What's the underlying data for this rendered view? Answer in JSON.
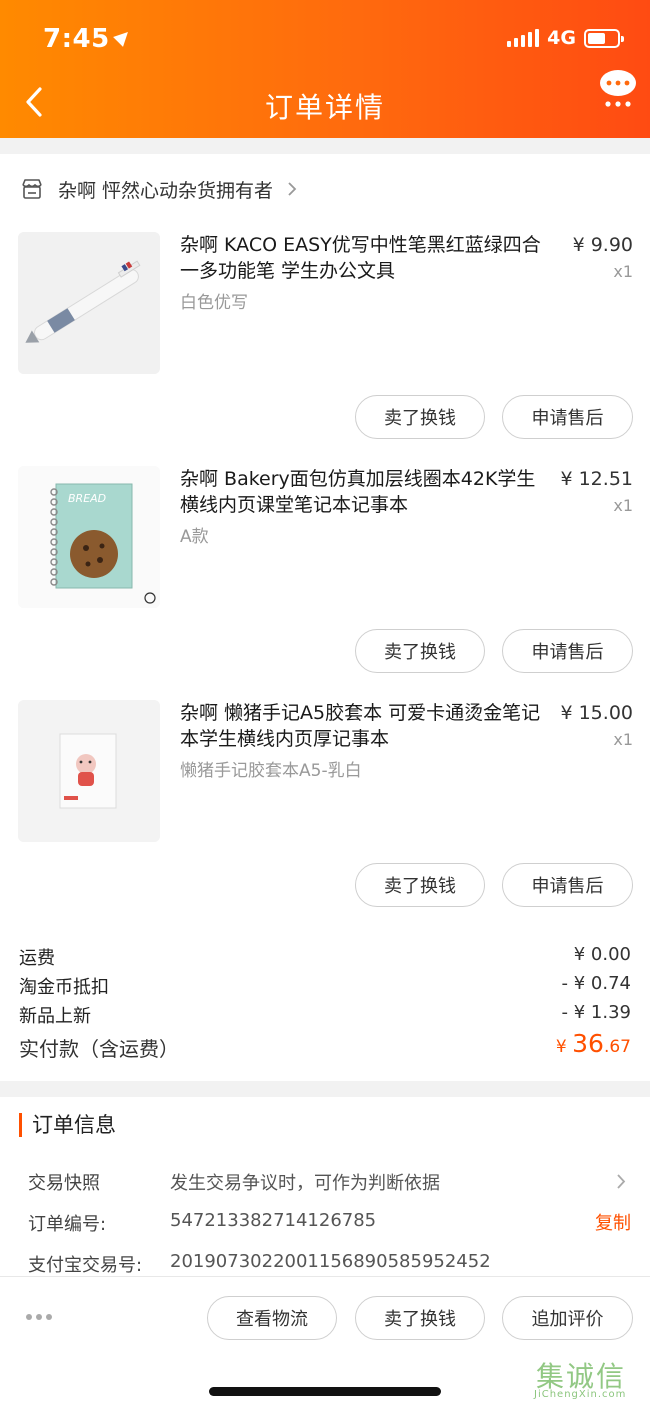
{
  "status_bar": {
    "time": "7:45",
    "network": "4G"
  },
  "header": {
    "title": "订单详情"
  },
  "shop": {
    "name": "杂啊 怦然心动杂货拥有者"
  },
  "items": [
    {
      "title": "杂啊 KACO EASY优写中性笔黑红蓝绿四合一多功能笔 学生办公文具",
      "sku": "白色优写",
      "price": "¥ 9.90",
      "qty": "x1",
      "sell_label": "卖了换钱",
      "after_sale_label": "申请售后"
    },
    {
      "title": "杂啊 Bakery面包仿真加层线圈本42K学生横线内页课堂笔记本记事本",
      "sku": "A款",
      "price": "¥ 12.51",
      "qty": "x1",
      "sell_label": "卖了换钱",
      "after_sale_label": "申请售后",
      "cover_text": "BREAD"
    },
    {
      "title": "杂啊 懒猪手记A5胶套本 可爱卡通烫金笔记本学生横线内页厚记事本",
      "sku": "懒猪手记胶套本A5-乳白",
      "price": "¥ 15.00",
      "qty": "x1",
      "sell_label": "卖了换钱",
      "after_sale_label": "申请售后"
    }
  ],
  "totals": {
    "shipping_label": "运费",
    "shipping_value": "¥ 0.00",
    "coin_label": "淘金币抵扣",
    "coin_value": "- ¥ 0.74",
    "new_label": "新品上新",
    "new_value": "- ¥ 1.39",
    "paid_label": "实付款（含运费）",
    "paid_currency": "¥ ",
    "paid_int": "36",
    "paid_dec": ".67"
  },
  "order_info": {
    "title": "订单信息",
    "snapshot_label": "交易快照",
    "snapshot_value": "发生交易争议时，可作为判断依据",
    "order_no_label": "订单编号:",
    "order_no_value": "547213382714126785",
    "copy_label": "复制",
    "alipay_label": "支付宝交易号:",
    "alipay_value": "2019073022001156890585952452"
  },
  "bottom_bar": {
    "logistics_label": "查看物流",
    "sell_label": "卖了换钱",
    "review_label": "追加评价"
  },
  "watermark": {
    "main": "集诚信",
    "sub": "JiChengXin.com"
  },
  "colors": {
    "accent": "#ff5000",
    "header_start": "#ff8a00",
    "header_end": "#ff4b12"
  }
}
